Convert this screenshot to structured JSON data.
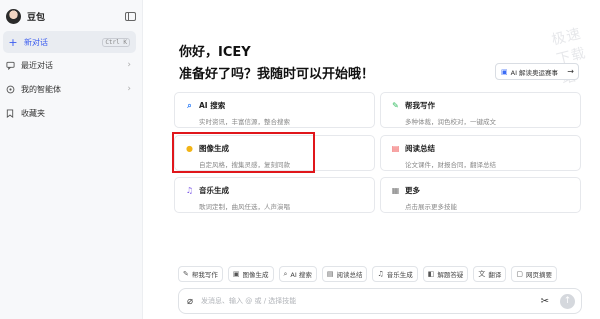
{
  "sidebar": {
    "app_name": "豆包",
    "shortcut": "Ctrl K",
    "items": [
      {
        "label": "新对话",
        "icon": "plus-icon"
      },
      {
        "label": "最近对话",
        "icon": "chat-icon"
      },
      {
        "label": "我的智能体",
        "icon": "agent-icon"
      },
      {
        "label": "收藏夹",
        "icon": "bookmark-icon"
      }
    ]
  },
  "main": {
    "greeting": "你好，ICEY",
    "headline": "准备好了吗？我随时可以开始哦！",
    "promo_label": "AI 解读奥运赛事",
    "watermark": "极速下载站"
  },
  "cards": [
    {
      "title": "AI 搜索",
      "desc": "实时资讯，丰富信源，整合搜索",
      "icon": "search-icon",
      "color": "#2f7ef7"
    },
    {
      "title": "帮我写作",
      "desc": "多种体裁，润色校对，一键成文",
      "icon": "pen-icon",
      "color": "#2dbb5c"
    },
    {
      "title": "图像生成",
      "desc": "自定风格，搜集灵感，复刻同款",
      "icon": "image-icon",
      "color": "#f2b416"
    },
    {
      "title": "阅读总结",
      "desc": "论文课件，财报合同，翻译总结",
      "icon": "reader-icon",
      "color": "#ef4b4b"
    },
    {
      "title": "音乐生成",
      "desc": "歌词定制，曲风任选，人声演唱",
      "icon": "music-icon",
      "color": "#7b57e6"
    },
    {
      "title": "更多",
      "desc": "点击展示更多技能",
      "icon": "grid-icon",
      "color": "#777777"
    }
  ],
  "chips": [
    {
      "label": "帮我写作",
      "icon": "pen-icon"
    },
    {
      "label": "图像生成",
      "icon": "image-icon"
    },
    {
      "label": "AI 搜索",
      "icon": "search-icon"
    },
    {
      "label": "阅读总结",
      "icon": "reader-icon"
    },
    {
      "label": "音乐生成",
      "icon": "music-icon"
    },
    {
      "label": "解题答疑",
      "icon": "question-icon"
    },
    {
      "label": "翻译",
      "icon": "translate-icon"
    },
    {
      "label": "网页摘要",
      "icon": "web-icon"
    }
  ],
  "input": {
    "placeholder": "发消息、输入 @ 或 / 选择技能"
  },
  "colors": {
    "accent": "#3b5cf0",
    "highlight_box": "#e0161b"
  }
}
